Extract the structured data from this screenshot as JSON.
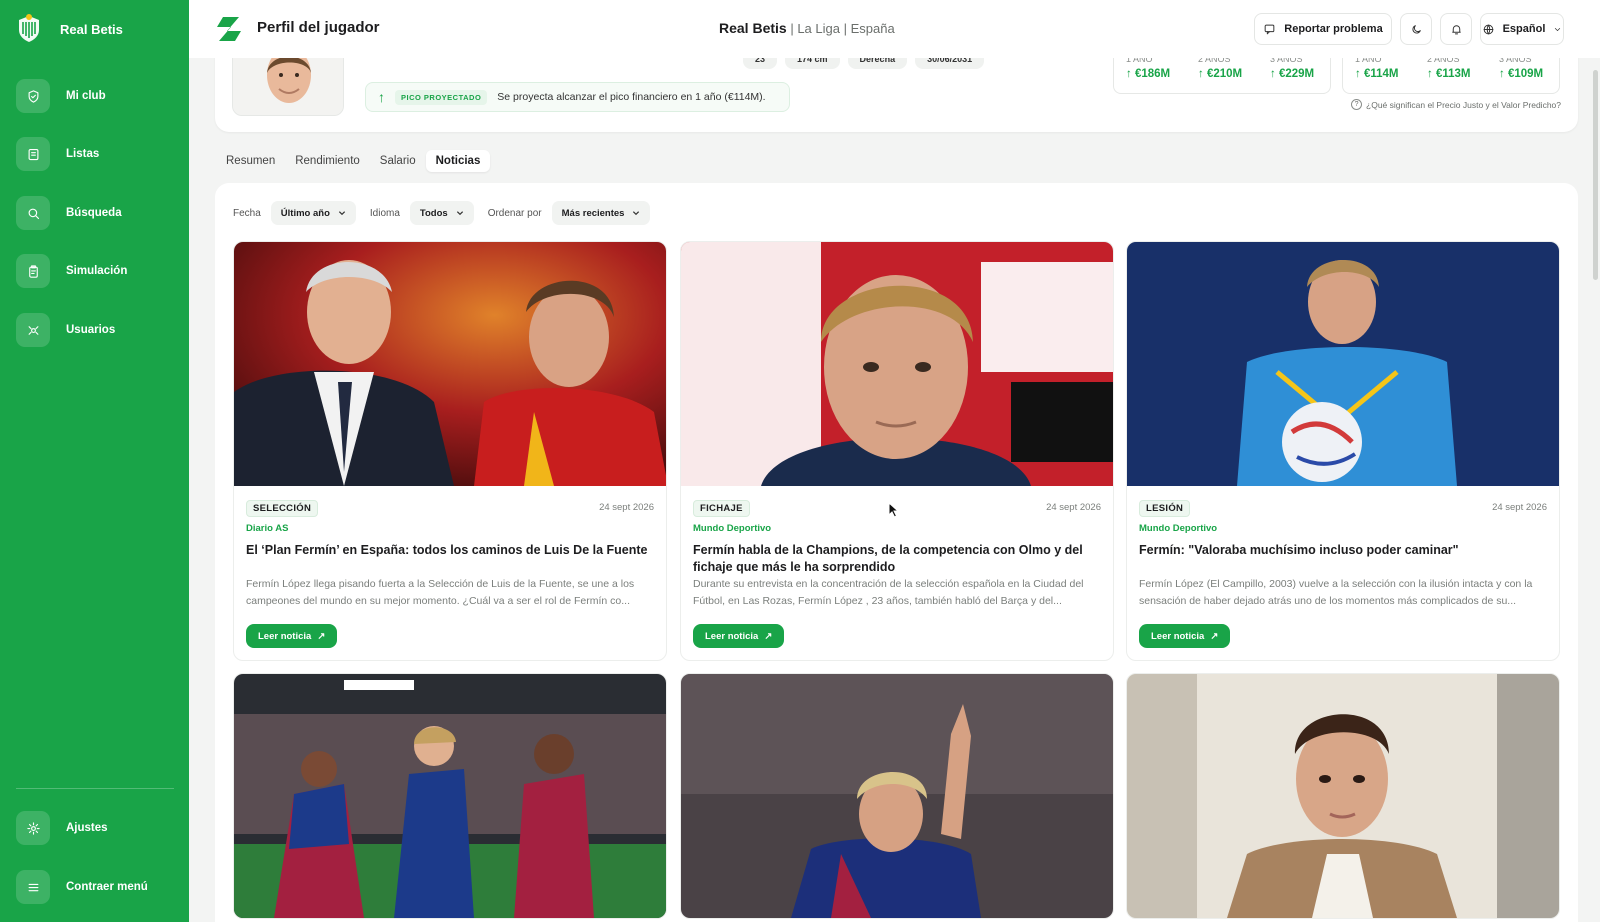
{
  "sidebar": {
    "brand": "Real Betis",
    "items": [
      {
        "label": "Mi club",
        "icon": "shield-icon"
      },
      {
        "label": "Listas",
        "icon": "list-icon"
      },
      {
        "label": "Búsqueda",
        "icon": "search-icon"
      },
      {
        "label": "Simulación",
        "icon": "clipboard-icon"
      },
      {
        "label": "Usuarios",
        "icon": "users-icon"
      }
    ],
    "bottom": [
      {
        "label": "Ajustes",
        "icon": "gear-icon"
      },
      {
        "label": "Contraer menú",
        "icon": "menu-icon"
      }
    ]
  },
  "header": {
    "title": "Perfil del jugador",
    "club": "Real Betis",
    "league": "La Liga",
    "country": "España",
    "report_label": "Reportar problema",
    "language": "Español"
  },
  "profile": {
    "chips": [
      "23",
      "174 cm",
      "Derecha",
      "30/06/2031"
    ],
    "peak_tag": "PICO PROYECTADO",
    "peak_text": "Se proyecta alcanzar el pico financiero en 1 año (€114M).",
    "fair_price": [
      {
        "h": "1 AÑO",
        "v": "€186M"
      },
      {
        "h": "2 AÑOS",
        "v": "€210M"
      },
      {
        "h": "3 AÑOS",
        "v": "€229M"
      }
    ],
    "predicted": [
      {
        "h": "1 AÑO",
        "v": "€114M"
      },
      {
        "h": "2 AÑOS",
        "v": "€113M"
      },
      {
        "h": "3 AÑOS",
        "v": "€109M"
      }
    ],
    "help_text": "¿Qué significan el Precio Justo y el Valor Predicho?"
  },
  "tabs": [
    "Resumen",
    "Rendimiento",
    "Salario",
    "Noticias"
  ],
  "active_tab": "Noticias",
  "filters": {
    "date_label": "Fecha",
    "date_value": "Último año",
    "lang_label": "Idioma",
    "lang_value": "Todos",
    "sort_label": "Ordenar por",
    "sort_value": "Más recientes"
  },
  "news": [
    {
      "category": "SELECCIÓN",
      "date": "24 sept 2026",
      "source": "Diario AS",
      "title": "El ‘Plan Fermín’ en España: todos los caminos de Luis De la Fuente",
      "excerpt": "Fermín López llega pisando fuerta a la Selección de Luis de la Fuente, se une a los campeones del mundo en su mejor momento. ¿Cuál va a ser el rol de Fermín co...",
      "button": "Leer noticia"
    },
    {
      "category": "FICHAJE",
      "date": "24 sept 2026",
      "source": "Mundo Deportivo",
      "title": "Fermín habla de la Champions, de la competencia con Olmo y del fichaje que más le ha sorprendido",
      "excerpt": "Durante su entrevista en la concentración de la selección española en la Ciudad del Fútbol, en Las Rozas, Fermín López , 23 años, también habló del Barça y del...",
      "button": "Leer noticia"
    },
    {
      "category": "LESIÓN",
      "date": "24 sept 2026",
      "source": "Mundo Deportivo",
      "title": "Fermín: \"Valoraba muchísimo incluso poder caminar\"",
      "excerpt": "Fermín López (El Campillo, 2003) vuelve a la selección con la ilusión intacta y con la sensación de haber dejado atrás uno de los momentos más complicados de su...",
      "button": "Leer noticia"
    }
  ],
  "colors": {
    "brand_green": "#19a448"
  }
}
